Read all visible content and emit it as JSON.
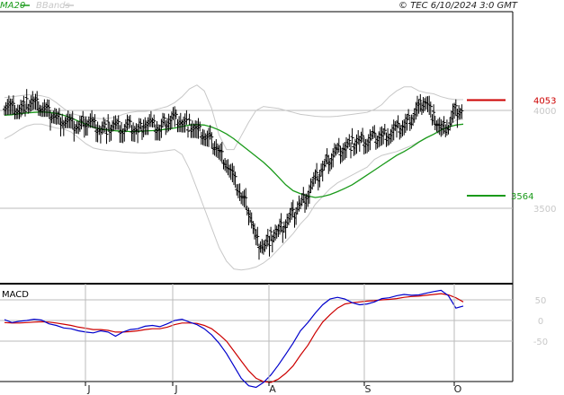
{
  "header": {
    "legend_ma": "MA20",
    "legend_bbands": "BBands",
    "copyright": "© TEC 6/10/2024 3:0 GMT"
  },
  "colors": {
    "ma": "#1a9a1a",
    "bbands": "#c8c8c8",
    "price_bars": "#000000",
    "resistance": "#cc0000",
    "support": "#1a9a1a",
    "macd": "#0000cc",
    "signal": "#cc0000",
    "grid": "#bbbbbb"
  },
  "chart_data": [
    {
      "type": "ohlc",
      "panel": "price",
      "title": "",
      "ylim": [
        3200,
        4180
      ],
      "y_ticks": [
        3500,
        4000
      ],
      "y_tick_labels": [
        "3500",
        "4000"
      ],
      "x_ticks": [
        "J",
        "J",
        "A",
        "S",
        "O"
      ],
      "levels": [
        {
          "name": "resistance",
          "value": 4053,
          "label": "4053",
          "color": "#cc0000"
        },
        {
          "name": "support",
          "value": 3564,
          "label": "3564",
          "color": "#1a9a1a"
        }
      ],
      "series": [
        {
          "name": "MA20",
          "values": [
            3975,
            3978,
            3983,
            3987,
            3990,
            3992,
            3990,
            3985,
            3975,
            3962,
            3945,
            3930,
            3914,
            3905,
            3900,
            3896,
            3894,
            3892,
            3893,
            3895,
            3897,
            3900,
            3905,
            3910,
            3918,
            3925,
            3928,
            3925,
            3915,
            3900,
            3880,
            3855,
            3825,
            3795,
            3765,
            3735,
            3700,
            3660,
            3620,
            3590,
            3575,
            3563,
            3555,
            3560,
            3570,
            3585,
            3602,
            3620,
            3645,
            3670,
            3695,
            3720,
            3745,
            3770,
            3790,
            3812,
            3838,
            3860,
            3878,
            3900,
            3915,
            3925,
            3930
          ]
        },
        {
          "name": "BBands upper",
          "values": [
            4065,
            4070,
            4075,
            4080,
            4080,
            4075,
            4065,
            4040,
            4010,
            3985,
            3975,
            3968,
            3962,
            3958,
            3960,
            3965,
            3980,
            3990,
            3995,
            3995,
            4000,
            4010,
            4020,
            4040,
            4070,
            4110,
            4130,
            4100,
            4010,
            3875,
            3800,
            3800,
            3870,
            3940,
            4000,
            4020,
            4015,
            4010,
            4000,
            3990,
            3980,
            3975,
            3970,
            3968,
            3968,
            3970,
            3975,
            3980,
            3985,
            3990,
            4005,
            4030,
            4070,
            4100,
            4120,
            4120,
            4100,
            4090,
            4085,
            4070,
            4060,
            4055,
            4055
          ]
        },
        {
          "name": "BBands lower",
          "values": [
            3855,
            3875,
            3900,
            3920,
            3930,
            3930,
            3920,
            3910,
            3905,
            3890,
            3860,
            3830,
            3808,
            3800,
            3795,
            3793,
            3788,
            3785,
            3783,
            3782,
            3785,
            3790,
            3795,
            3800,
            3775,
            3700,
            3600,
            3500,
            3400,
            3300,
            3230,
            3190,
            3185,
            3190,
            3200,
            3220,
            3250,
            3290,
            3330,
            3370,
            3420,
            3460,
            3520,
            3560,
            3600,
            3630,
            3650,
            3670,
            3690,
            3710,
            3750,
            3770,
            3780,
            3790,
            3805,
            3820,
            3840,
            3860,
            3880,
            3900,
            3920,
            3950,
            3955
          ]
        },
        {
          "name": "Close",
          "values": [
            4030,
            4015,
            4000,
            4030,
            4040,
            4010,
            3990,
            3960,
            3950,
            3930,
            3910,
            3950,
            3930,
            3900,
            3910,
            3920,
            3900,
            3920,
            3890,
            3940,
            3920,
            3900,
            3950,
            3960,
            3940,
            3920,
            3900,
            3870,
            3840,
            3790,
            3730,
            3650,
            3560,
            3500,
            3340,
            3300,
            3350,
            3380,
            3420,
            3470,
            3520,
            3580,
            3640,
            3700,
            3760,
            3790,
            3810,
            3830,
            3840,
            3840,
            3860,
            3870,
            3880,
            3900,
            3920,
            3960,
            4020,
            4050,
            3960,
            3900,
            3920,
            4000,
            3990
          ]
        }
      ]
    },
    {
      "type": "line",
      "panel": "macd",
      "title": "MACD",
      "ylim": [
        -185,
        65
      ],
      "y_ticks": [
        50,
        0,
        -50
      ],
      "y_tick_labels": [
        "50",
        "0",
        "-50"
      ],
      "series": [
        {
          "name": "MACD",
          "values": [
            2,
            -5,
            -2,
            0,
            3,
            1,
            -8,
            -12,
            -18,
            -20,
            -25,
            -28,
            -30,
            -25,
            -28,
            -38,
            -28,
            -22,
            -20,
            -14,
            -12,
            -15,
            -8,
            0,
            3,
            -4,
            -10,
            -20,
            -35,
            -55,
            -80,
            -110,
            -140,
            -158,
            -162,
            -150,
            -132,
            -108,
            -82,
            -55,
            -25,
            -5,
            18,
            38,
            52,
            56,
            52,
            43,
            38,
            40,
            45,
            53,
            55,
            60,
            63,
            61,
            62,
            66,
            70,
            73,
            60,
            30,
            35
          ]
        },
        {
          "name": "Signal",
          "values": [
            -5,
            -6,
            -6,
            -5,
            -4,
            -3,
            -4,
            -6,
            -9,
            -12,
            -16,
            -19,
            -22,
            -22,
            -24,
            -28,
            -28,
            -27,
            -25,
            -22,
            -20,
            -20,
            -16,
            -10,
            -6,
            -6,
            -7,
            -12,
            -20,
            -34,
            -50,
            -74,
            -98,
            -122,
            -140,
            -148,
            -150,
            -142,
            -128,
            -110,
            -84,
            -60,
            -30,
            -4,
            14,
            30,
            40,
            43,
            45,
            47,
            48,
            50,
            51,
            53,
            56,
            58,
            59,
            61,
            63,
            65,
            62,
            55,
            45
          ]
        }
      ]
    }
  ]
}
